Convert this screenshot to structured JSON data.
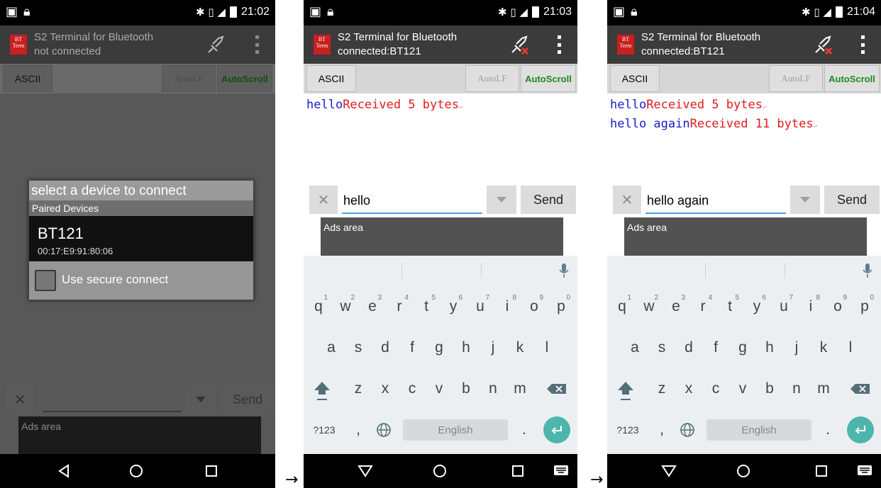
{
  "app": {
    "title": "S2 Terminal for Bluetooth",
    "logo_top": "BT",
    "logo_bottom": "Term",
    "colors": {
      "appbar": "#3b3b3b",
      "sent_text": "#1a1acc",
      "received_text": "#e01b1b",
      "autoscroll": "#1b8a1b",
      "enter_key": "#4db6ac"
    }
  },
  "screens": [
    {
      "status": {
        "time": "21:02",
        "network": "H"
      },
      "subtitle": "not connected",
      "buttons": {
        "ascii": "ASCII",
        "autolf": "AutoLF",
        "autoscroll": "AutoScroll"
      },
      "dialog": {
        "title": "select a device to connect",
        "section": "Paired Devices",
        "device_name": "BT121",
        "device_mac": "00:17:E9:91:80:06",
        "secure_label": "Use secure connect"
      },
      "input": {
        "value": "",
        "send": "Send",
        "clear": "✕"
      },
      "ads": "Ads area"
    },
    {
      "status": {
        "time": "21:03",
        "network": "H"
      },
      "subtitle": "connected:BT121",
      "buttons": {
        "ascii": "ASCII",
        "autolf": "AutoLF",
        "autoscroll": "AutoScroll"
      },
      "terminal": [
        {
          "sent": "hello",
          "received": "Received 5 bytes"
        }
      ],
      "input": {
        "value": "hello",
        "send": "Send",
        "clear": "✕"
      },
      "ads": "Ads area"
    },
    {
      "status": {
        "time": "21:04",
        "network": "3G"
      },
      "subtitle": "connected:BT121",
      "buttons": {
        "ascii": "ASCII",
        "autolf": "AutoLF",
        "autoscroll": "AutoScroll"
      },
      "terminal": [
        {
          "sent": "hello",
          "received": "Received 5 bytes"
        },
        {
          "sent": "hello again",
          "received": "Received 11 bytes"
        }
      ],
      "input": {
        "value": "hello again",
        "send": "Send",
        "clear": "✕"
      },
      "ads": "Ads area"
    }
  ],
  "keyboard": {
    "row1": [
      "q",
      "w",
      "e",
      "r",
      "t",
      "y",
      "u",
      "i",
      "o",
      "p"
    ],
    "row1_digits": [
      "1",
      "2",
      "3",
      "4",
      "5",
      "6",
      "7",
      "8",
      "9",
      "0"
    ],
    "row2": [
      "a",
      "s",
      "d",
      "f",
      "g",
      "h",
      "j",
      "k",
      "l"
    ],
    "row3": [
      "z",
      "x",
      "c",
      "v",
      "b",
      "n",
      "m"
    ],
    "symbols": "?123",
    "comma": ",",
    "period": ".",
    "space": "English"
  },
  "arrows": [
    "→",
    "→"
  ]
}
